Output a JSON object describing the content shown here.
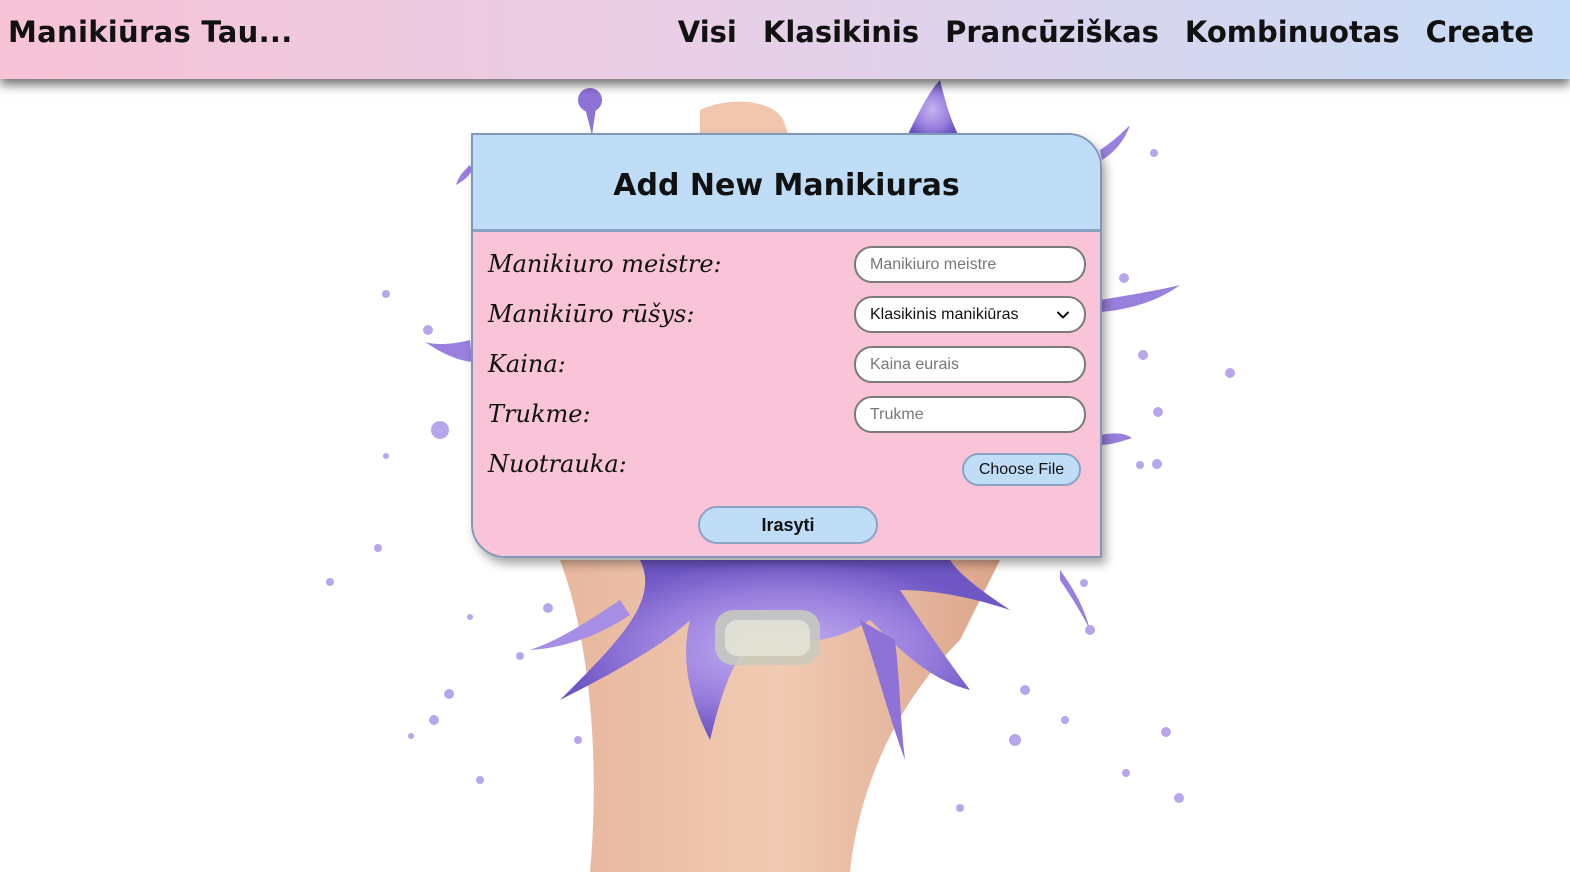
{
  "navbar": {
    "brand": "Manikiūras Tau...",
    "links": [
      "Visi",
      "Klasikinis",
      "Prancūziškas",
      "Kombinuotas",
      "Create"
    ]
  },
  "form": {
    "title": "Add New Manikiuras",
    "fields": {
      "master": {
        "label": "Manikiuro meistre:",
        "placeholder": "Manikiuro meistre",
        "value": ""
      },
      "type": {
        "label": "Manikiūro rūšys:",
        "selected": "Klasikinis manikiūras"
      },
      "price": {
        "label": "Kaina:",
        "placeholder": "Kaina eurais",
        "value": ""
      },
      "duration": {
        "label": "Trukme:",
        "placeholder": "Trukme",
        "value": ""
      },
      "photo": {
        "label": "Nuotrauka:",
        "button": "Choose File"
      }
    },
    "submit": "Irasyti"
  },
  "colors": {
    "nav_gradient_start": "#f7c2d6",
    "nav_gradient_end": "#c6dcf7",
    "card_header": "#c0ddf7",
    "card_body": "#f8b6d0",
    "splash": "#9a80de"
  },
  "background": {
    "image": "hand-with-purple-nail-polish-splash"
  }
}
